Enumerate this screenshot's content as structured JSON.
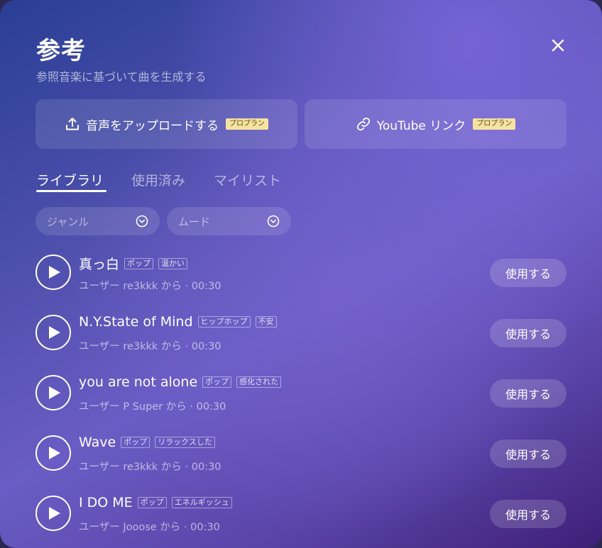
{
  "header": {
    "title": "参考",
    "subtitle": "参照音楽に基づいて曲を生成する"
  },
  "upload": {
    "audio_label": "音声をアップロードする",
    "audio_badge": "プロプラン",
    "youtube_label": "YouTube リンク",
    "youtube_badge": "プロプラン"
  },
  "tabs": [
    {
      "label": "ライブラリ",
      "active": true
    },
    {
      "label": "使用済み",
      "active": false
    },
    {
      "label": "マイリスト",
      "active": false
    }
  ],
  "filters": {
    "genre_placeholder": "ジャンル",
    "mood_placeholder": "ムード"
  },
  "songs": [
    {
      "title": "真っ白",
      "tags": [
        "ポップ",
        "温かい"
      ],
      "meta": "ユーザー re3kkk から · 00:30",
      "action": "使用する"
    },
    {
      "title": "N.Y.State of Mind",
      "tags": [
        "ヒップホップ",
        "不安"
      ],
      "meta": "ユーザー re3kkk から · 00:30",
      "action": "使用する"
    },
    {
      "title": "you are not alone",
      "tags": [
        "ポップ",
        "感化された"
      ],
      "meta": "ユーザー P Super から · 00:30",
      "action": "使用する"
    },
    {
      "title": "Wave",
      "tags": [
        "ポップ",
        "リラックスした"
      ],
      "meta": "ユーザー re3kkk から · 00:30",
      "action": "使用する"
    },
    {
      "title": "I DO ME",
      "tags": [
        "ポップ",
        "エネルギッシュ"
      ],
      "meta": "ユーザー Jooose から · 00:30",
      "action": "使用する"
    }
  ],
  "icons": {
    "close": "close-icon",
    "upload": "upload-icon",
    "link": "link-icon",
    "play": "play-icon",
    "chevron": "chevron-down-circle-icon"
  },
  "colors": {
    "badge_bg": "#f7e3a1",
    "badge_text": "#5a4310"
  }
}
